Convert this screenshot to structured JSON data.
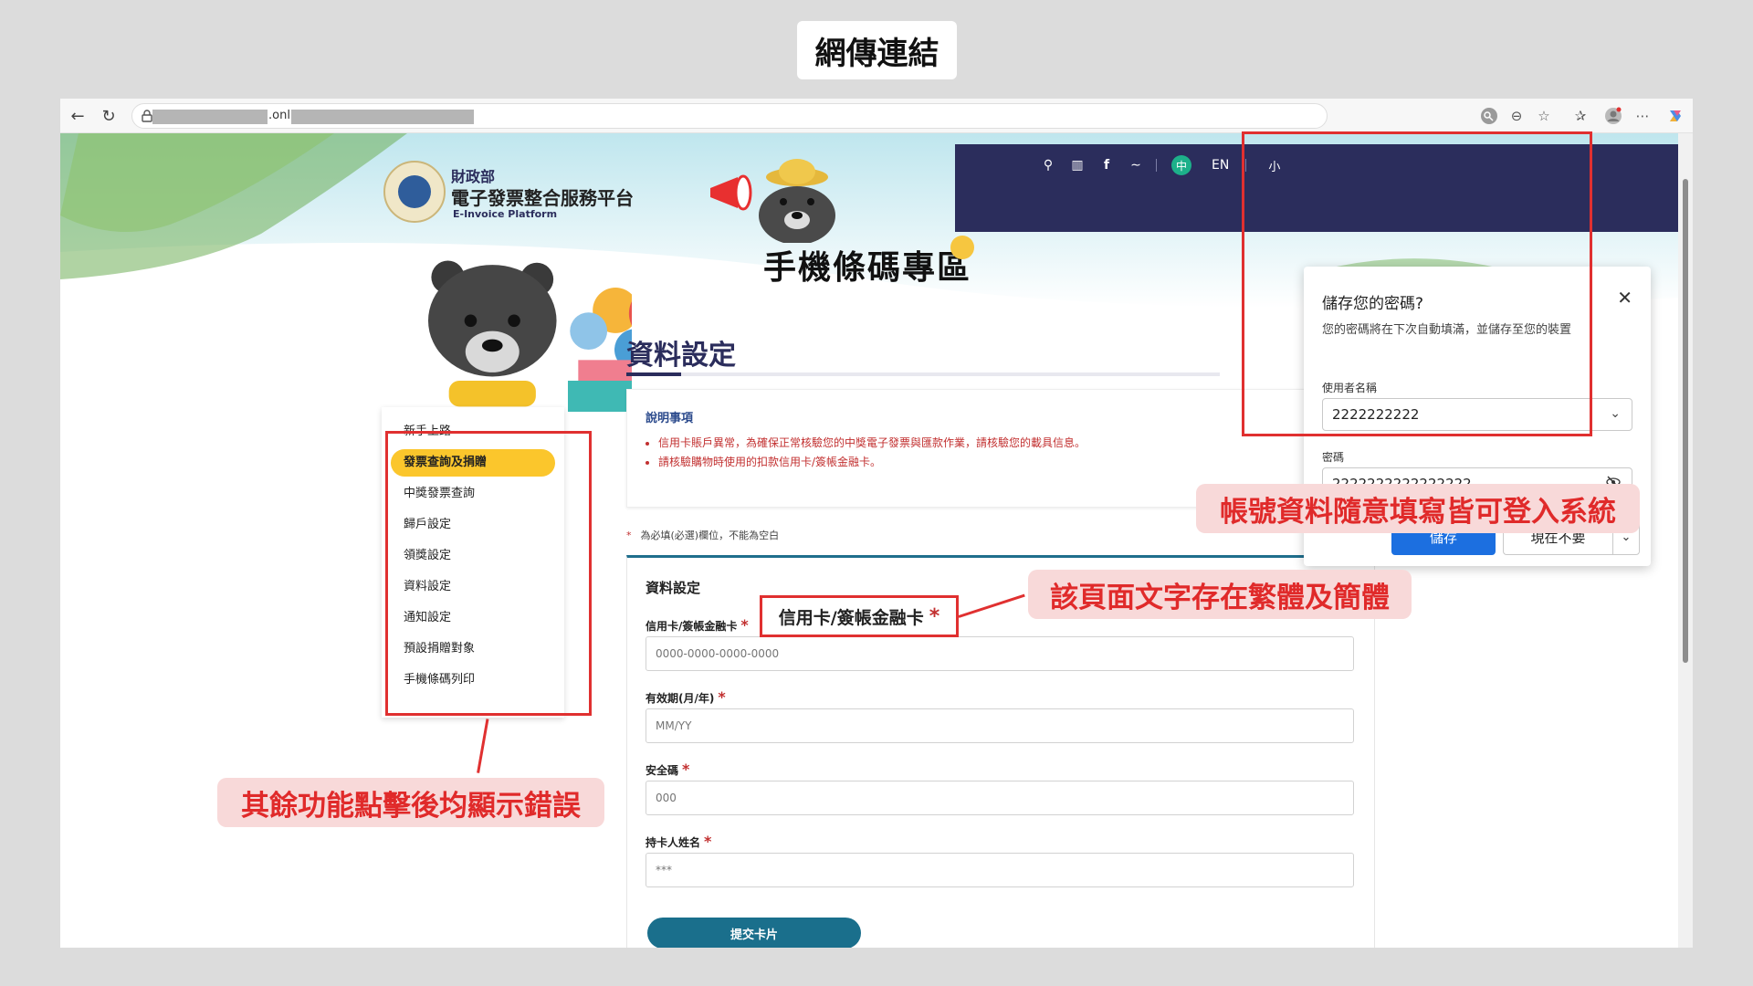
{
  "slide": {
    "title": "網傳連結"
  },
  "browser": {
    "url_visible_fragment": ".onl"
  },
  "site": {
    "ministry": "財政部",
    "platform_name": "電子發票整合服務平台",
    "platform_name_en": "E-Invoice Platform",
    "hero_title": "手機條碼專區",
    "nav": {
      "lang_zh": "中",
      "lang_en": "EN",
      "font_small": "小"
    }
  },
  "sidebar": {
    "items": [
      {
        "label": "新手上路"
      },
      {
        "label": "發票查詢及捐贈"
      },
      {
        "label": "中獎發票查詢"
      },
      {
        "label": "歸戶設定"
      },
      {
        "label": "領獎設定"
      },
      {
        "label": "資料設定"
      },
      {
        "label": "通知設定"
      },
      {
        "label": "預設捐贈對象"
      },
      {
        "label": "手機條碼列印"
      }
    ],
    "active_index": 1
  },
  "main": {
    "section_title": "資料設定",
    "notice": {
      "title": "說明事項",
      "items": [
        "信用卡賬戶異常，為確保正常核驗您的中獎電子發票與匯款作業，請核驗您的載具信息。",
        "請核驗購物時使用的扣款信用卡/簽帳金融卡。"
      ]
    },
    "required_note": "為必填(必選)欄位，不能為空白",
    "required_star": "*",
    "form": {
      "heading": "資料設定",
      "fields": [
        {
          "label": "信用卡/簽帳金融卡",
          "placeholder": "0000-0000-0000-0000"
        },
        {
          "label": "有效期(月/年)",
          "placeholder": "MM/YY"
        },
        {
          "label": "安全碼",
          "placeholder": "000"
        },
        {
          "label": "持卡人姓名",
          "placeholder": "***"
        }
      ],
      "submit_label": "提交卡片"
    }
  },
  "password_dialog": {
    "title": "儲存您的密碼?",
    "description": "您的密碼將在下次自動填滿，並儲存至您的裝置",
    "username_label": "使用者名稱",
    "username_value": "2222222222",
    "password_label": "密碼",
    "password_value": "2222222222222222",
    "save_label": "儲存",
    "not_now_label": "現在不要"
  },
  "annotations": {
    "login_any": "帳號資料隨意填寫皆可登入系統",
    "mixed_script": "該頁面文字存在繁體及簡體",
    "callout_label": "信用卡/簽帳金融卡",
    "other_functions_error": "其餘功能點擊後均顯示錯誤"
  },
  "colors": {
    "annotation_red": "#e03030",
    "annotation_bg": "#f8d9d9",
    "site_navy": "#2b2d5c",
    "active_menu": "#fbc62c",
    "submit_teal": "#1a6f8c",
    "save_blue": "#1c6fe0"
  }
}
